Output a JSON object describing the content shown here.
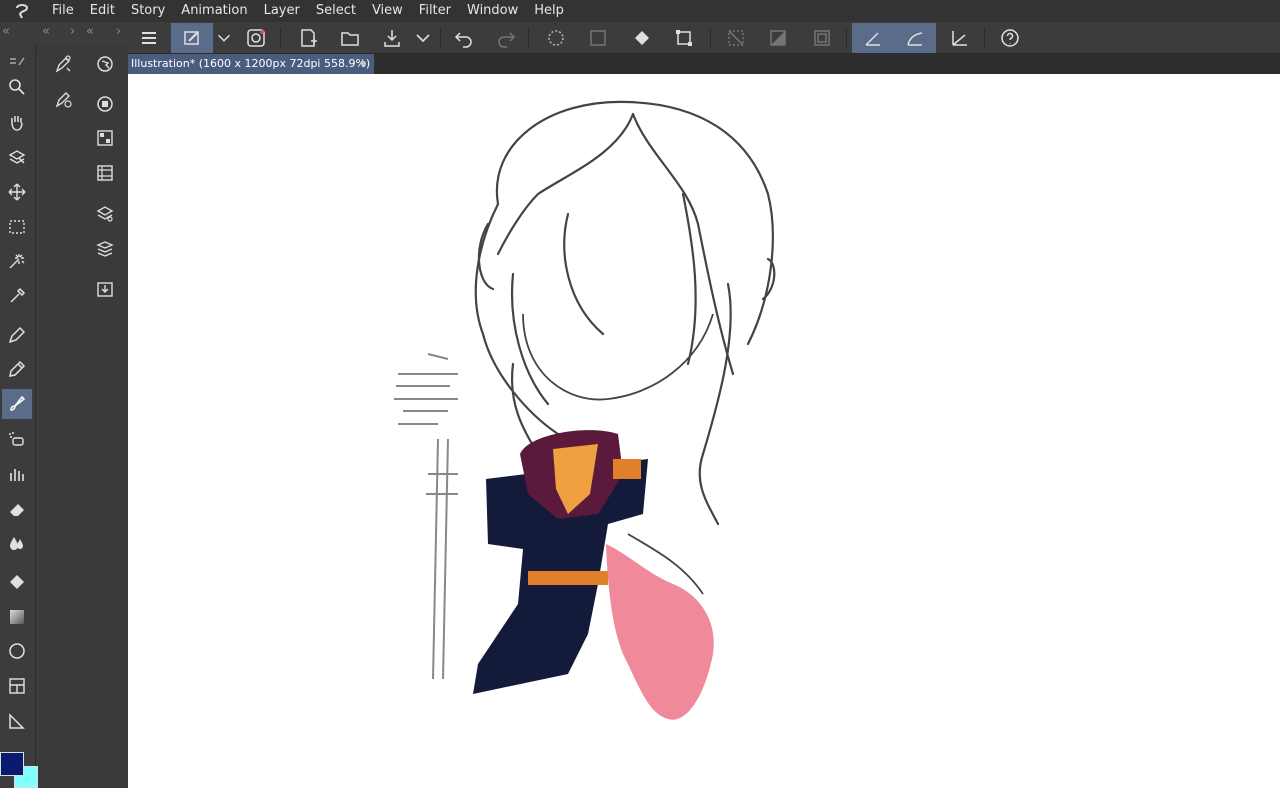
{
  "menubar": {
    "items": [
      "File",
      "Edit",
      "Story",
      "Animation",
      "Layer",
      "Select",
      "View",
      "Filter",
      "Window",
      "Help"
    ]
  },
  "document": {
    "tab_title": "Illustration* (1600 x 1200px 72dpi 558.9%)",
    "tab_modified_indicator": "•"
  },
  "colors": {
    "main_color": "#0a1a6e",
    "sub_color": "#7fffff",
    "active_highlight": "#5a6c8a",
    "tab_highlight": "#4a5d7e"
  },
  "toolbox": {
    "tools": [
      "zoom",
      "hand",
      "operation",
      "move-layer",
      "selection",
      "auto-select",
      "eyedropper",
      "pen",
      "pencil",
      "brush",
      "airbrush",
      "decoration",
      "eraser",
      "blend",
      "fill",
      "gradient",
      "figure",
      "frame-border",
      "ruler"
    ],
    "active_tool": "brush"
  },
  "command_bar": {
    "icons": [
      "menu-icon",
      "quick-access-icon",
      "dropdown-icon",
      "companion-icon",
      "new-icon",
      "open-icon",
      "save-icon",
      "dropdown-icon",
      "undo-icon",
      "redo-icon",
      "loading-icon",
      "clear-icon",
      "fill-icon",
      "transform-icon",
      "deselect-icon",
      "invert-icon",
      "show-selection-icon",
      "snap-ruler-icon",
      "snap-special-ruler-icon",
      "snap-grid-icon",
      "help-icon"
    ]
  }
}
